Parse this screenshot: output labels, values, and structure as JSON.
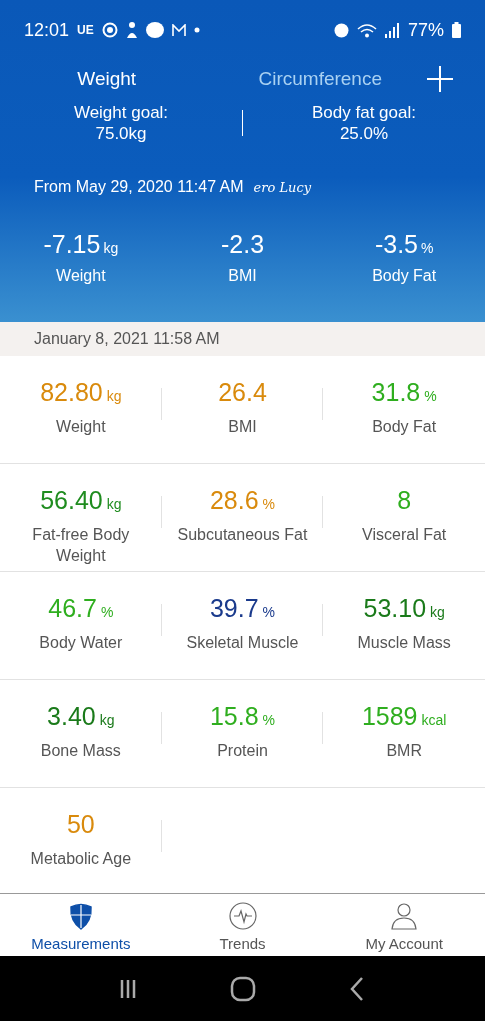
{
  "status_bar": {
    "time": "12:01",
    "carrier": "UE",
    "battery": "77%"
  },
  "tabs": [
    {
      "label": "Weight",
      "selected": true
    },
    {
      "label": "Circumference",
      "selected": false
    }
  ],
  "goals": [
    {
      "label": "Weight goal:",
      "value": "75.0kg"
    },
    {
      "label": "Body fat goal:",
      "value": "25.0%"
    }
  ],
  "since": {
    "text": "From May 29, 2020 11:47 AM",
    "scale": "ero Lucy"
  },
  "changes": [
    {
      "value": "-7.15",
      "unit": "kg",
      "label": "Weight"
    },
    {
      "value": "-2.3",
      "label": "BMI"
    },
    {
      "value": "-3.5",
      "unit": "%",
      "label": "Body Fat"
    }
  ],
  "date": "January 8, 2021 11:58 AM",
  "metrics": [
    {
      "value": "82.80",
      "unit": "kg",
      "label": "Weight",
      "color": "#d98a0c"
    },
    {
      "value": "26.4",
      "label": "BMI",
      "color": "#d98a0c"
    },
    {
      "value": "31.8",
      "unit": "%",
      "label": "Body Fat",
      "color": "#2fae1f"
    },
    {
      "value": "56.40",
      "unit": "kg",
      "label": "Fat-free Body Weight",
      "color": "#1f8c1f"
    },
    {
      "value": "28.6",
      "unit": "%",
      "label": "Subcutaneous Fat",
      "color": "#d98a0c"
    },
    {
      "value": "8",
      "label": "Visceral Fat",
      "color": "#2fae1f"
    },
    {
      "value": "46.7",
      "unit": "%",
      "label": "Body Water",
      "color": "#2fae1f"
    },
    {
      "value": "39.7",
      "unit": "%",
      "label": "Skeletal Muscle",
      "color": "#1a3a8c"
    },
    {
      "value": "53.10",
      "unit": "kg",
      "label": "Muscle Mass",
      "color": "#1a7a1a"
    },
    {
      "value": "3.40",
      "unit": "kg",
      "label": "Bone Mass",
      "color": "#1a7a1a"
    },
    {
      "value": "15.8",
      "unit": "%",
      "label": "Protein",
      "color": "#2fae1f"
    },
    {
      "value": "1589",
      "unit": "kcal",
      "label": "BMR",
      "color": "#2fae1f"
    },
    {
      "value": "50",
      "label": "Metabolic Age",
      "color": "#d98a0c"
    }
  ],
  "nav": [
    {
      "label": "Measurements",
      "selected": true
    },
    {
      "label": "Trends",
      "selected": false
    },
    {
      "label": "My Account",
      "selected": false
    }
  ]
}
